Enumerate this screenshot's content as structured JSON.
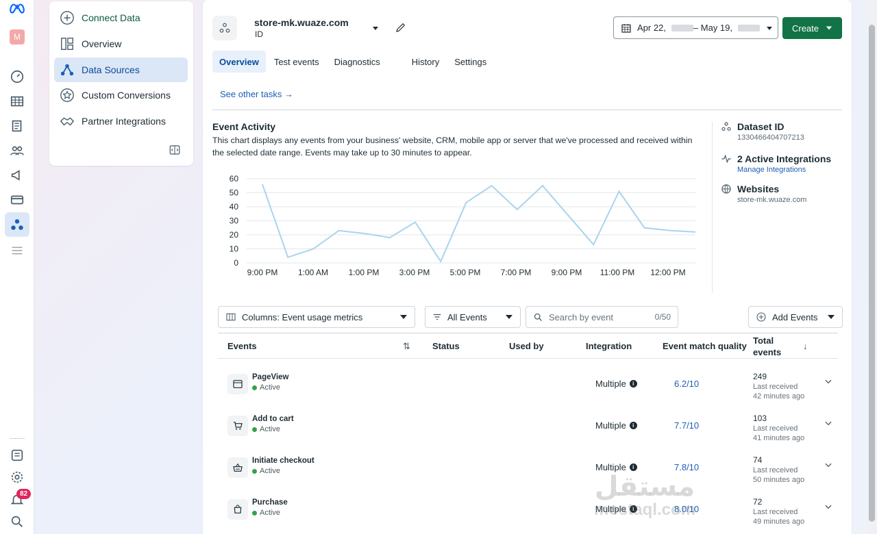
{
  "rail": {
    "avatar_letter": "M",
    "notification_count": "82"
  },
  "sidenav": {
    "items": [
      {
        "label": "Connect Data"
      },
      {
        "label": "Overview"
      },
      {
        "label": "Data Sources"
      },
      {
        "label": "Custom Conversions"
      },
      {
        "label": "Partner Integrations"
      }
    ]
  },
  "header": {
    "dataset_name": "store-mk.wuaze.com",
    "dataset_sub": "ID",
    "date_start": "Apr 22,",
    "date_mid": "– May 19,",
    "create_label": "Create"
  },
  "tabs": [
    {
      "label": "Overview"
    },
    {
      "label": "Test events"
    },
    {
      "label": "Diagnostics"
    },
    {
      "label": "History"
    },
    {
      "label": "Settings"
    }
  ],
  "see_other_tasks": "See other tasks →",
  "event_activity": {
    "title": "Event Activity",
    "description": "This chart displays any events from your business' website, CRM, mobile app or server that we've processed and received within the selected date range. Events may take up to 30 minutes to appear."
  },
  "chart_data": {
    "type": "line",
    "title": "",
    "xlabel": "",
    "ylabel": "",
    "ylim": [
      0,
      60
    ],
    "yticks": [
      0,
      10,
      20,
      30,
      40,
      50,
      60
    ],
    "xtick_labels": [
      "9:00 PM",
      "1:00 AM",
      "1:00 PM",
      "3:00 PM",
      "5:00 PM",
      "7:00 PM",
      "9:00 PM",
      "11:00 PM",
      "12:00 PM"
    ],
    "grid": true,
    "legend": "none",
    "color": "#a8d4ee",
    "series": [
      {
        "values": [
          56,
          4,
          10,
          23,
          21,
          18,
          29,
          1,
          43,
          55,
          38,
          55,
          34,
          13,
          51,
          25,
          23,
          22
        ]
      }
    ]
  },
  "info": {
    "dataset_id_label": "Dataset ID",
    "dataset_id_value": "1330466404707213",
    "integrations_label": "2 Active Integrations",
    "integrations_link": "Manage Integrations",
    "websites_label": "Websites",
    "websites_value": "store-mk.wuaze.com"
  },
  "controls": {
    "columns_label": "Columns: Event usage metrics",
    "filter_label": "All Events",
    "search_placeholder": "Search by event",
    "search_count": "0/50",
    "add_events_label": "Add Events"
  },
  "table": {
    "headers": {
      "events": "Events",
      "status": "Status",
      "used_by": "Used by",
      "integration": "Integration",
      "emq": "Event match quality",
      "total": "Total events"
    },
    "rows": [
      {
        "name": "PageView",
        "status": "Active",
        "integration": "Multiple",
        "emq": "6.2/10",
        "total": "249",
        "last": "Last received 42 minutes ago"
      },
      {
        "name": "Add to cart",
        "status": "Active",
        "integration": "Multiple",
        "emq": "7.7/10",
        "total": "103",
        "last": "Last received 41 minutes ago"
      },
      {
        "name": "Initiate checkout",
        "status": "Active",
        "integration": "Multiple",
        "emq": "7.8/10",
        "total": "74",
        "last": "Last received 50 minutes ago"
      },
      {
        "name": "Purchase",
        "status": "Active",
        "integration": "Multiple",
        "emq": "8.0/10",
        "total": "72",
        "last": "Last received 49 minutes ago"
      }
    ]
  },
  "watermark": {
    "arabic": "مستقل",
    "latin": "mostaql.com"
  }
}
